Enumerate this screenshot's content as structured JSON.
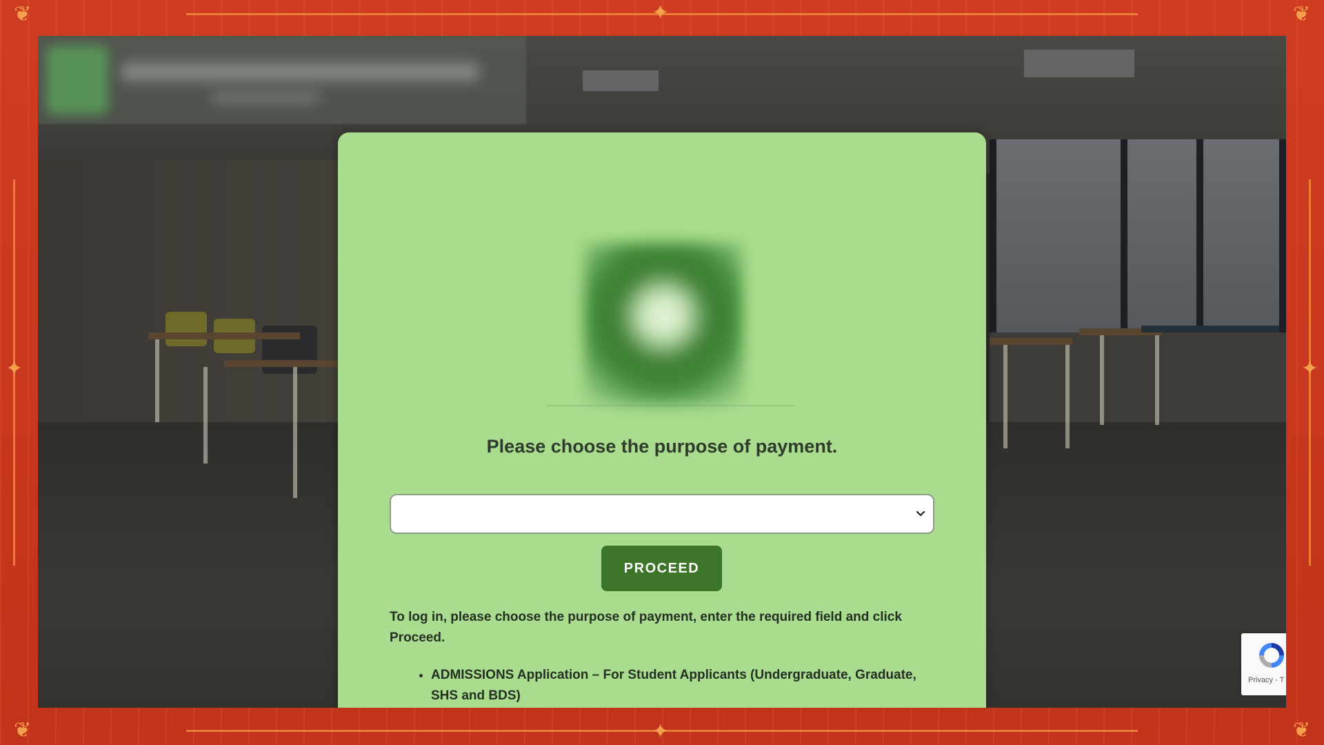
{
  "heading": "Please choose the purpose of payment.",
  "purpose_select": {
    "selected_value": "",
    "options": []
  },
  "proceed_button": "PROCEED",
  "instructions": "To log in, please choose the purpose of payment, enter the required field and click Proceed.",
  "options_list": [
    "ADMISSIONS Application – For Student Applicants (Undergraduate, Graduate, SHS and BDS)"
  ],
  "recaptcha": {
    "text": "Privacy - T",
    "icon": "recaptcha-logo-icon"
  },
  "colors": {
    "card_background": "#a9dc8f",
    "proceed_button": "#3c7528",
    "frame": "#c7391f",
    "frame_ornament": "#f5a04c"
  }
}
